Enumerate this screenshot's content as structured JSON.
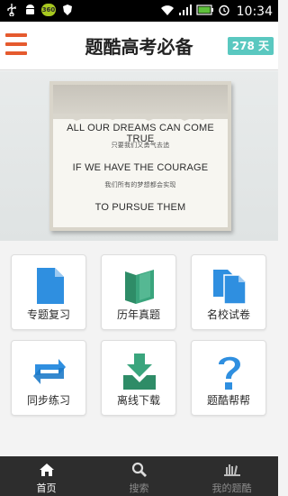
{
  "status_bar": {
    "time": "10:34",
    "left_icons": [
      "usb-icon",
      "android-debug-icon",
      "bean-icon",
      "shield-icon"
    ],
    "right_icons": [
      "wifi-icon",
      "signal-icon",
      "battery-icon",
      "alarm-icon"
    ],
    "bean_text": "360"
  },
  "header": {
    "title": "题酷高考必备",
    "days_badge": "278 天"
  },
  "banner": {
    "line1": "ALL OUR DREAMS CAN COME TRUE",
    "line1_cn": "只要我们又勇气去追",
    "line2": "IF WE HAVE THE COURAGE",
    "line2_cn": "我们所有的梦想都会实现",
    "line3": "TO PURSUE THEM"
  },
  "grid": {
    "tiles": [
      {
        "label": "专题复习",
        "icon": "document-icon"
      },
      {
        "label": "历年真题",
        "icon": "book-icon"
      },
      {
        "label": "名校试卷",
        "icon": "papers-icon"
      },
      {
        "label": "同步练习",
        "icon": "sync-icon"
      },
      {
        "label": "离线下载",
        "icon": "download-icon"
      },
      {
        "label": "题酷帮帮",
        "icon": "question-icon"
      }
    ]
  },
  "bottom_nav": {
    "items": [
      {
        "label": "首页",
        "icon": "home-icon",
        "active": true
      },
      {
        "label": "搜索",
        "icon": "search-icon",
        "active": false
      },
      {
        "label": "我的题酷",
        "icon": "bookshelf-icon",
        "active": false
      }
    ]
  },
  "colors": {
    "accent_blue": "#2f8fe0",
    "accent_green": "#3aa57d",
    "menu_orange": "#e55a2e",
    "badge_teal": "#5ac8c0",
    "nav_bg": "#2d2d2d"
  }
}
